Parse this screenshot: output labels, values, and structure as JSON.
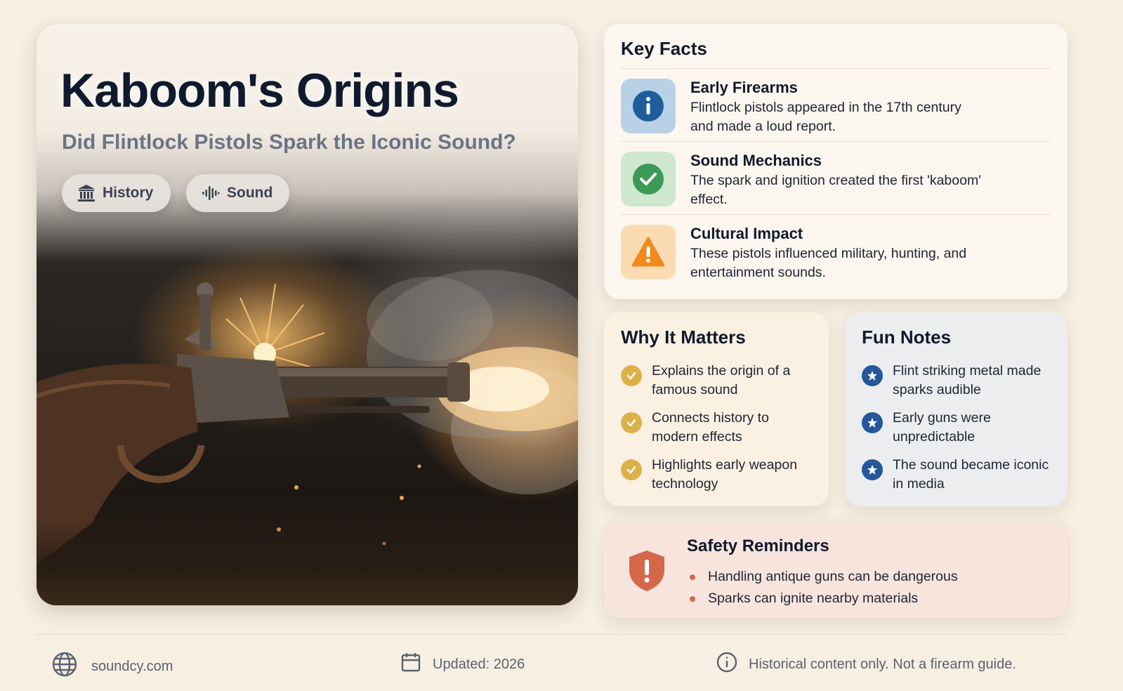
{
  "hero": {
    "title": "Kaboom's Origins",
    "subtitle": "Did Flintlock Pistols Spark the Iconic Sound?",
    "tags": [
      {
        "label": "History",
        "icon": "bank-icon"
      },
      {
        "label": "Sound",
        "icon": "soundwave-icon"
      }
    ]
  },
  "key_facts": {
    "heading": "Key Facts",
    "items": [
      {
        "title": "Early Firearms",
        "text": "Flintlock pistols appeared in the 17th century and made a loud report.",
        "icon": "info-icon",
        "color": "#1f5e9b"
      },
      {
        "title": "Sound Mechanics",
        "text": "The spark and ignition created the first 'kaboom' effect.",
        "icon": "check-icon",
        "color": "#3c9a55"
      },
      {
        "title": "Cultural Impact",
        "text": "These pistols influenced military, hunting, and entertainment sounds.",
        "icon": "warning-icon",
        "color": "#f08a1c"
      }
    ]
  },
  "why_it_matters": {
    "heading": "Why It Matters",
    "items": [
      "Explains the origin of a famous sound",
      "Connects history to modern effects",
      "Highlights early weapon technology"
    ]
  },
  "fun_notes": {
    "heading": "Fun Notes",
    "items": [
      "Flint striking metal made sparks audible",
      "Early guns were unpredictable",
      "The sound became iconic in media"
    ]
  },
  "safety": {
    "heading": "Safety Reminders",
    "items": [
      "Handling antique guns can be dangerous",
      "Sparks can ignite nearby materials"
    ]
  },
  "footer": {
    "site": "soundcy.com",
    "updated": "Updated: 2026",
    "note": "Historical content only. Not a firearm guide."
  },
  "colors": {
    "page_bg": "#f6efe2",
    "title": "#0f1a2e",
    "why_check": "#dbb24a",
    "fun_star": "#24589a",
    "safety_accent": "#d5684a"
  }
}
